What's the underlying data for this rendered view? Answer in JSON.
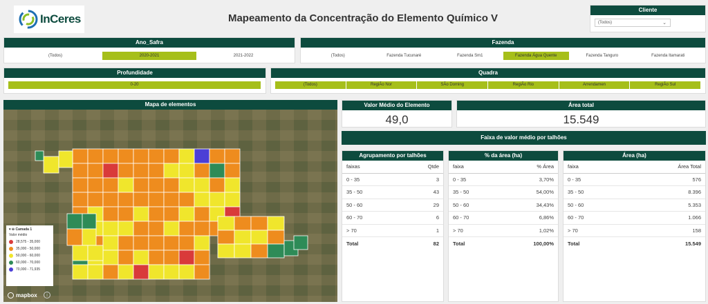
{
  "logo": {
    "text": "InCeres"
  },
  "title": "Mapeamento da Concentração do Elemento Químico V",
  "cliente": {
    "header": "Cliente",
    "value": "(Todos)"
  },
  "ano_safra": {
    "header": "Ano_Safra",
    "options": [
      "(Todos)",
      "2020-2021",
      "2021-2022"
    ],
    "selected": 1
  },
  "fazenda": {
    "header": "Fazenda",
    "options": [
      "(Todos)",
      "Fazenda Tucunaré",
      "Fazenda Sm1",
      "Fazenda Água Quente",
      "Fazenda Tanguro",
      "Fazenda Itamarati"
    ],
    "selected": 3
  },
  "profundidade": {
    "header": "Profundidade",
    "options": [
      "0-20"
    ]
  },
  "quadra": {
    "header": "Quadra",
    "options": [
      "(Todos)",
      "RegiÃo Nor",
      "SÃo Doming",
      "RegiÃo Rio",
      "Arrendamen",
      "RegiÃo Sul"
    ]
  },
  "map": {
    "header": "Mapa de elementos",
    "legend_layer": "Camada 1",
    "legend_title": "Valor médio",
    "legend": [
      {
        "label": "28,575 - 35,000",
        "color": "#d93a3a"
      },
      {
        "label": "35,000 - 50,000",
        "color": "#ee8c1e"
      },
      {
        "label": "50,000 - 60,000",
        "color": "#f0e62c"
      },
      {
        "label": "60,000 - 70,000",
        "color": "#2e8b57"
      },
      {
        "label": "70,000 - 71,935",
        "color": "#4b3fd6"
      }
    ],
    "attribution": "mapbox"
  },
  "kpi": {
    "valor_medio": {
      "header": "Valor Médio do Elemento",
      "value": "49,0"
    },
    "area_total": {
      "header": "Área total",
      "value": "15.549"
    }
  },
  "faixa_header": "Faixa de valor médio por talhões",
  "tables": {
    "agrupamento": {
      "header": "Agrupamento por talhões",
      "cols": [
        "faixas",
        "Qtde"
      ],
      "rows": [
        [
          "0 - 35",
          "3"
        ],
        [
          "35 - 50",
          "43"
        ],
        [
          "50 - 60",
          "29"
        ],
        [
          "60 - 70",
          "6"
        ],
        [
          "> 70",
          "1"
        ]
      ],
      "total": [
        "Total",
        "82"
      ]
    },
    "pct_area": {
      "header": "% da área (ha)",
      "cols": [
        "faixa",
        "% Área"
      ],
      "rows": [
        [
          "0 - 35",
          "3,70%"
        ],
        [
          "35 - 50",
          "54,00%"
        ],
        [
          "50 - 60",
          "34,43%"
        ],
        [
          "60 - 70",
          "6,86%"
        ],
        [
          "> 70",
          "1,02%"
        ]
      ],
      "total": [
        "Total",
        "100,00%"
      ]
    },
    "area": {
      "header": "Área (ha)",
      "cols": [
        "faixa",
        "Área Total"
      ],
      "rows": [
        [
          "0 - 35",
          "576"
        ],
        [
          "35 - 50",
          "8.396"
        ],
        [
          "50 - 60",
          "5.353"
        ],
        [
          "60 - 70",
          "1.066"
        ],
        [
          "> 70",
          "158"
        ]
      ],
      "total": [
        "Total",
        "15.549"
      ]
    }
  }
}
